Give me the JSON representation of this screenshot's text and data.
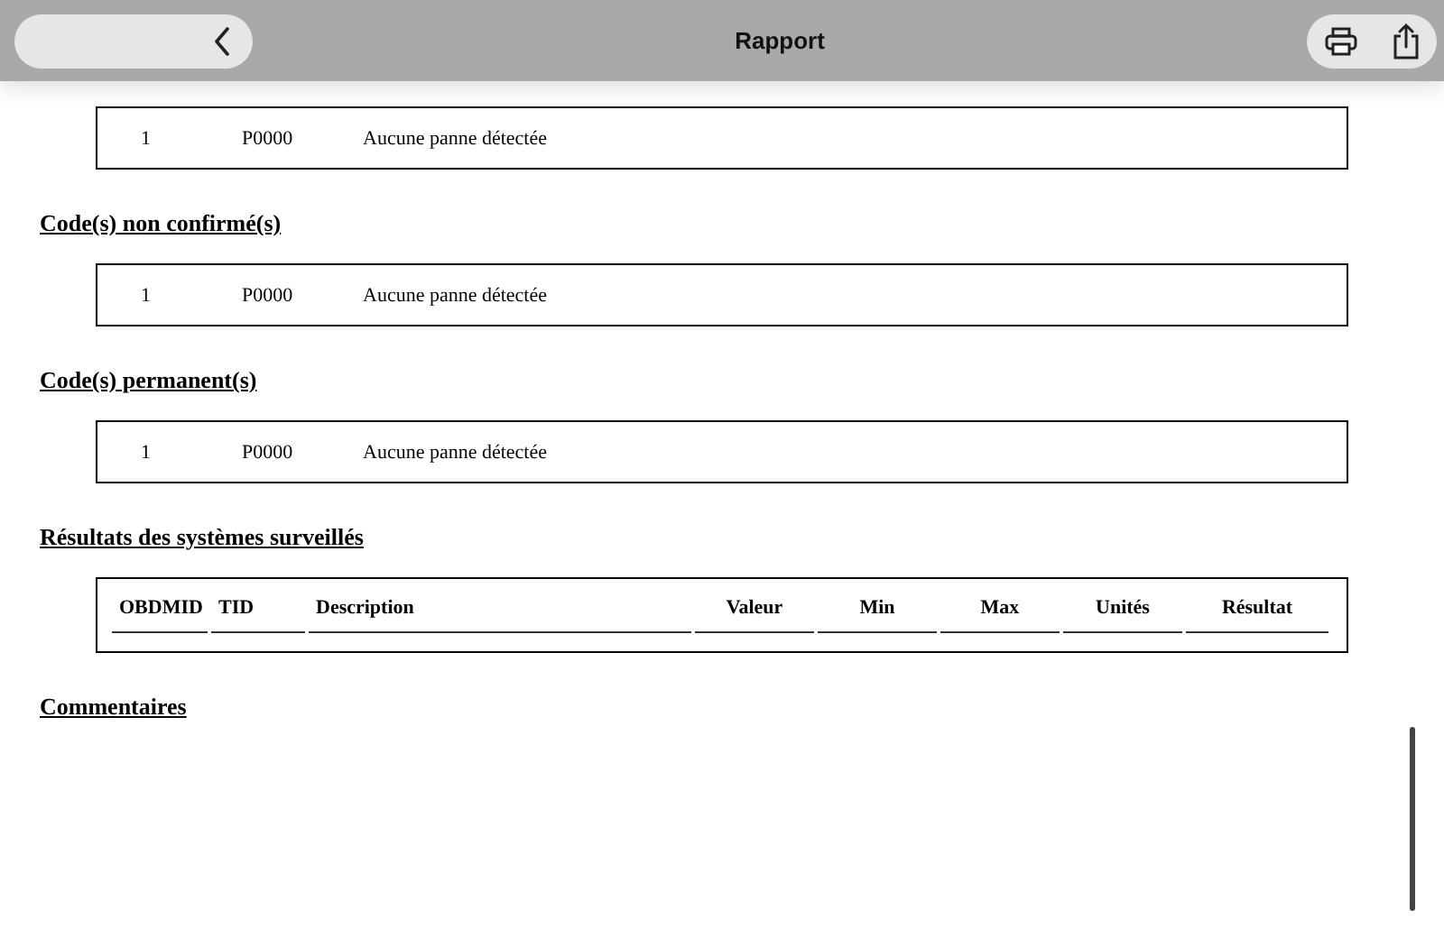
{
  "window": {
    "title": "Rapport"
  },
  "code_sections": [
    {
      "rows": [
        {
          "index": "1",
          "code": "P0000",
          "description": "Aucune panne détectée"
        }
      ]
    },
    {
      "heading": "Code(s) non confirmé(s)",
      "rows": [
        {
          "index": "1",
          "code": "P0000",
          "description": "Aucune panne détectée"
        }
      ]
    },
    {
      "heading": "Code(s) permanent(s)",
      "rows": [
        {
          "index": "1",
          "code": "P0000",
          "description": "Aucune panne détectée"
        }
      ]
    }
  ],
  "monitor_results": {
    "heading": "Résultats des systèmes surveillés",
    "columns": [
      "OBDMID",
      "TID",
      "Description",
      "Valeur",
      "Min",
      "Max",
      "Unités",
      "Résultat"
    ]
  },
  "comments": {
    "heading": "Commentaires"
  }
}
